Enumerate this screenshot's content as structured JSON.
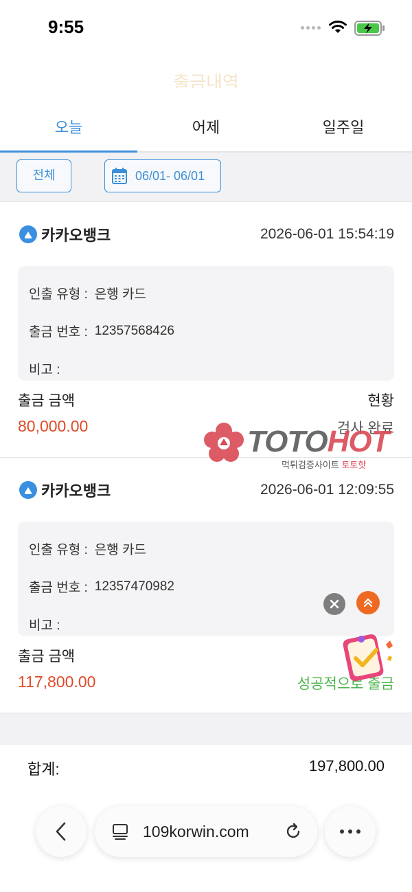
{
  "status_bar": {
    "time": "9:55"
  },
  "page": {
    "title_faded": "출금내역"
  },
  "tabs": [
    {
      "label": "오늘",
      "active": true
    },
    {
      "label": "어제",
      "active": false
    },
    {
      "label": "일주일",
      "active": false
    }
  ],
  "filters": {
    "all_label": "전체",
    "date_range": "06/01- 06/01"
  },
  "records": [
    {
      "bank_name": "카카오뱅크",
      "datetime": "2026-06-01 15:54:19",
      "withdraw_type_label": "인출 유형 :",
      "withdraw_type_value": "은행 카드",
      "number_label": "출금 번호 :",
      "number_value": "12357568426",
      "memo_label": "비고 :",
      "memo_value": "",
      "amount_label": "출금 금액",
      "amount_value": "80,000.00",
      "status_label": "현황",
      "status_value": "검사 완료"
    },
    {
      "bank_name": "카카오뱅크",
      "datetime": "2026-06-01 12:09:55",
      "withdraw_type_label": "인출 유형 :",
      "withdraw_type_value": "은행 카드",
      "number_label": "출금 번호 :",
      "number_value": "12357470982",
      "memo_label": "비고 :",
      "memo_value": "",
      "amount_label": "출금 금액",
      "amount_value": "117,800.00",
      "status_value": "성공적으로 출금"
    }
  ],
  "watermark": {
    "brand_a": "TOTO",
    "brand_b": "HOT",
    "sub_a": "먹튀검증사이트",
    "sub_b": "토토핫"
  },
  "total": {
    "label": "합계:",
    "value": "197,800.00"
  },
  "browser": {
    "url": "109korwin.com"
  },
  "colors": {
    "accent": "#3d8fd8",
    "amount": "#e04a28",
    "success": "#4bb44b"
  }
}
